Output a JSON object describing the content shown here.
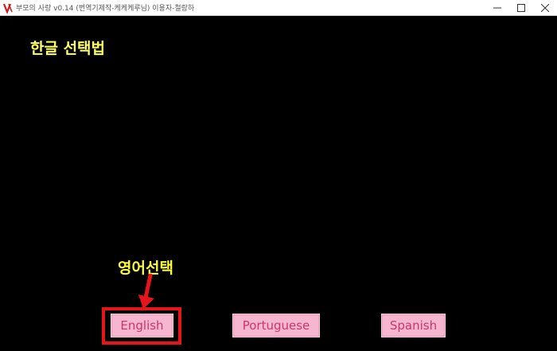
{
  "window": {
    "title": "부모의 사랑 v0.14 (번역기제작-케케케루님) 이용자-철랑하",
    "icon": "app-logo-icon",
    "controls": [
      "minimize-icon",
      "maximize-icon",
      "close-icon"
    ]
  },
  "main": {
    "heading": "한글 선택법",
    "annotation": "영어선택",
    "annotation_color": "#ffff33",
    "highlight_color": "#e8141b"
  },
  "languages": [
    {
      "label": "English"
    },
    {
      "label": "Portuguese"
    },
    {
      "label": "Spanish"
    }
  ],
  "colors": {
    "background": "#000000",
    "heading": "#ffff66",
    "button_bg": "#f6b6cf",
    "button_text": "#c8386e"
  }
}
